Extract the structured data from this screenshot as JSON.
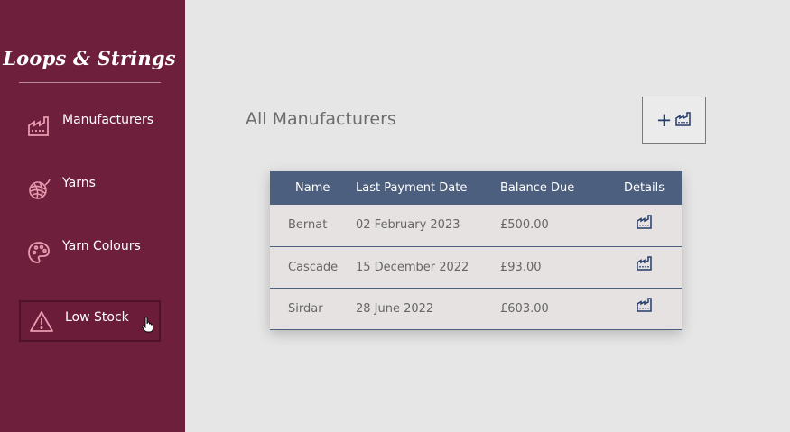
{
  "app": {
    "brand": "Loops & Strings"
  },
  "sidebar": {
    "items": [
      {
        "label": "Manufacturers",
        "icon": "factory-icon"
      },
      {
        "label": "Yarns",
        "icon": "yarn-ball-icon"
      },
      {
        "label": "Yarn Colours",
        "icon": "palette-icon"
      },
      {
        "label": "Low Stock",
        "icon": "warning-icon",
        "active": true
      }
    ]
  },
  "main": {
    "title": "All Manufacturers",
    "add_button": {
      "symbol": "+",
      "icon": "factory-icon"
    },
    "table": {
      "headers": [
        "Name",
        "Last Payment Date",
        "Balance Due",
        "Details"
      ],
      "rows": [
        {
          "name": "Bernat",
          "last_payment": "02 February 2023",
          "balance": "£500.00"
        },
        {
          "name": "Cascade",
          "last_payment": "15 December 2022",
          "balance": "£93.00"
        },
        {
          "name": "Sirdar",
          "last_payment": "28 June 2022",
          "balance": "£603.00"
        }
      ]
    }
  },
  "colors": {
    "sidebar_bg": "#6e1f3c",
    "icon_pink": "#e89bb0",
    "table_header": "#4d5f7f",
    "accent_navy": "#243d6b"
  }
}
